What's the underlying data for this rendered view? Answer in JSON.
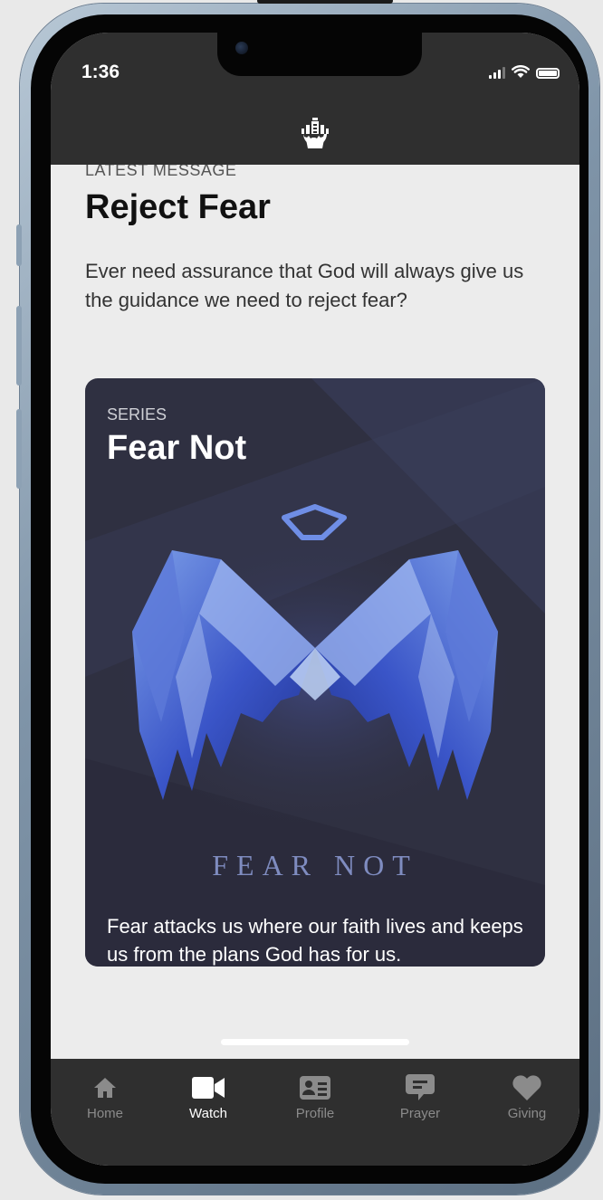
{
  "status_bar": {
    "time": "1:36"
  },
  "latest": {
    "eyebrow": "LATEST MESSAGE",
    "title": "Reject Fear",
    "description": "Ever need assurance that God will always give us the guidance we need to reject fear?"
  },
  "series_card": {
    "eyebrow": "SERIES",
    "title": "Fear Not",
    "art_title": "FEAR NOT",
    "description": "Fear attacks us where our faith lives and keeps us from the plans God has for us."
  },
  "tabs": [
    {
      "label": "Home",
      "icon": "home-icon",
      "active": false
    },
    {
      "label": "Watch",
      "icon": "video-camera-icon",
      "active": true
    },
    {
      "label": "Profile",
      "icon": "id-card-icon",
      "active": false
    },
    {
      "label": "Prayer",
      "icon": "chat-bubble-icon",
      "active": false
    },
    {
      "label": "Giving",
      "icon": "heart-icon",
      "active": false
    }
  ],
  "colors": {
    "bar_background": "#2f2f2f",
    "screen_background": "#ececec",
    "card_background": "#2f3041",
    "active_tab": "#ffffff",
    "inactive_tab": "#8b8b8b"
  }
}
